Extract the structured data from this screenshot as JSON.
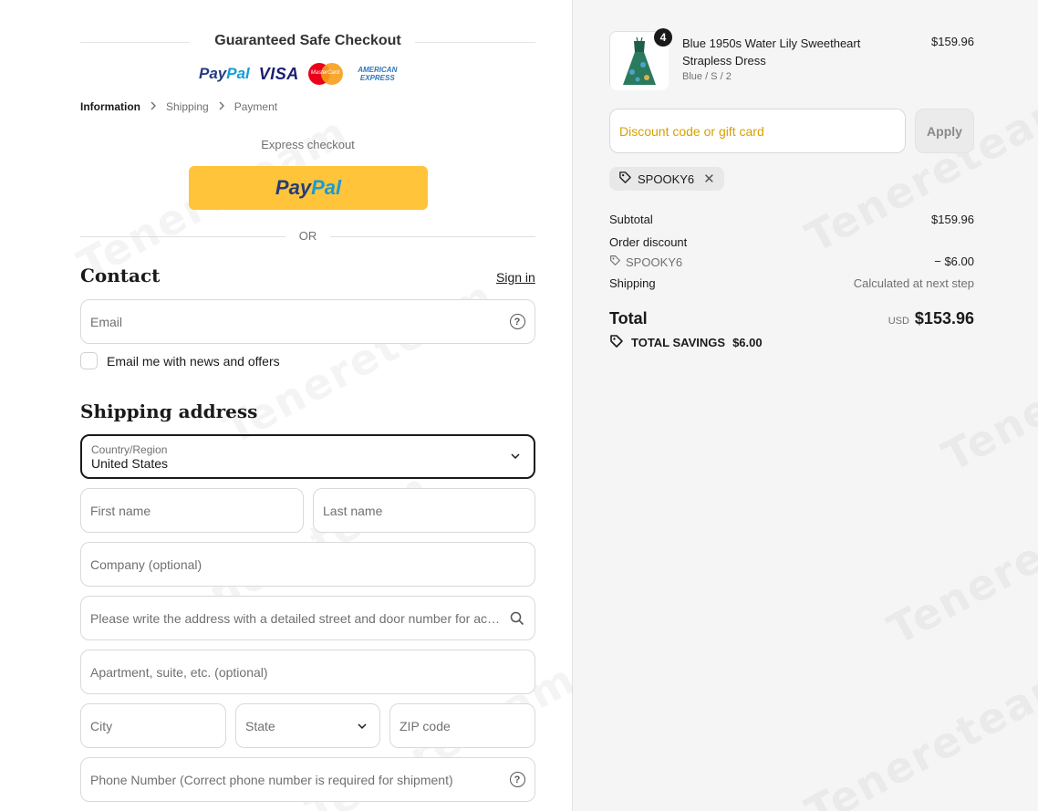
{
  "header": {
    "title": "Guaranteed Safe Checkout",
    "payment_logos": [
      "PayPal",
      "VISA",
      "MasterCard",
      "AMERICAN EXPRESS"
    ]
  },
  "breadcrumb": {
    "items": [
      "Information",
      "Shipping",
      "Payment"
    ],
    "active": "Information"
  },
  "express": {
    "label": "Express checkout",
    "paypal_button": "PayPal",
    "or_label": "OR"
  },
  "contact": {
    "heading": "Contact",
    "sign_in": "Sign in",
    "email_placeholder": "Email",
    "newsletter_label": "Email me with news and offers"
  },
  "shipping": {
    "heading": "Shipping address",
    "country_label": "Country/Region",
    "country_value": "United States",
    "first_name": "First name",
    "last_name": "Last name",
    "company": "Company (optional)",
    "address": "Please write the address with a detailed street and door number for accurate delivery",
    "apartment": "Apartment, suite, etc. (optional)",
    "city": "City",
    "state": "State",
    "zip": "ZIP code",
    "phone": "Phone Number (Correct phone number is required for shipment)"
  },
  "cart": {
    "quantity_badge": "4",
    "product_name": "Blue 1950s Water Lily Sweetheart Strapless Dress",
    "product_variant": "Blue / S / 2",
    "product_price": "$159.96"
  },
  "discount": {
    "placeholder": "Discount code or gift card",
    "apply": "Apply",
    "applied_code": "SPOOKY6"
  },
  "summary": {
    "subtotal_label": "Subtotal",
    "subtotal_value": "$159.96",
    "order_discount_label": "Order discount",
    "discount_code": "SPOOKY6",
    "discount_value": "− $6.00",
    "shipping_label": "Shipping",
    "shipping_value": "Calculated at next step",
    "total_label": "Total",
    "currency": "USD",
    "total_value": "$153.96",
    "savings_label": "TOTAL SAVINGS",
    "savings_value": "$6.00"
  },
  "watermark": "Tenereteam",
  "colors": {
    "paypal_yellow": "#ffc439",
    "discount_placeholder": "#d9a000",
    "summary_bg": "#f5f5f5"
  }
}
